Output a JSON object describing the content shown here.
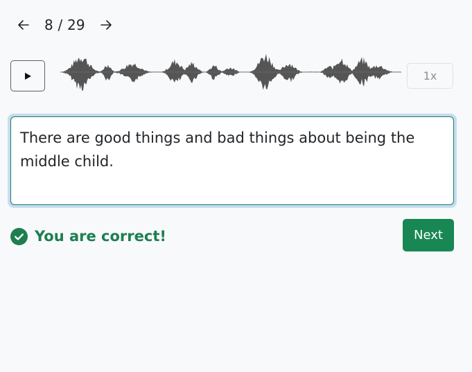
{
  "navigation": {
    "prev_icon": "arrow-left-icon",
    "counter": "8 / 29",
    "next_icon": "arrow-right-icon"
  },
  "player": {
    "play_icon": "play-icon",
    "waveform_icon": "waveform-icon",
    "speed_label": "1x"
  },
  "answer": {
    "value": "There are good things and bad things about being the middle child."
  },
  "feedback": {
    "icon": "check-circle-icon",
    "message": "You are correct!",
    "color": "#1e7e50"
  },
  "actions": {
    "next_label": "Next",
    "next_color": "#198754"
  }
}
